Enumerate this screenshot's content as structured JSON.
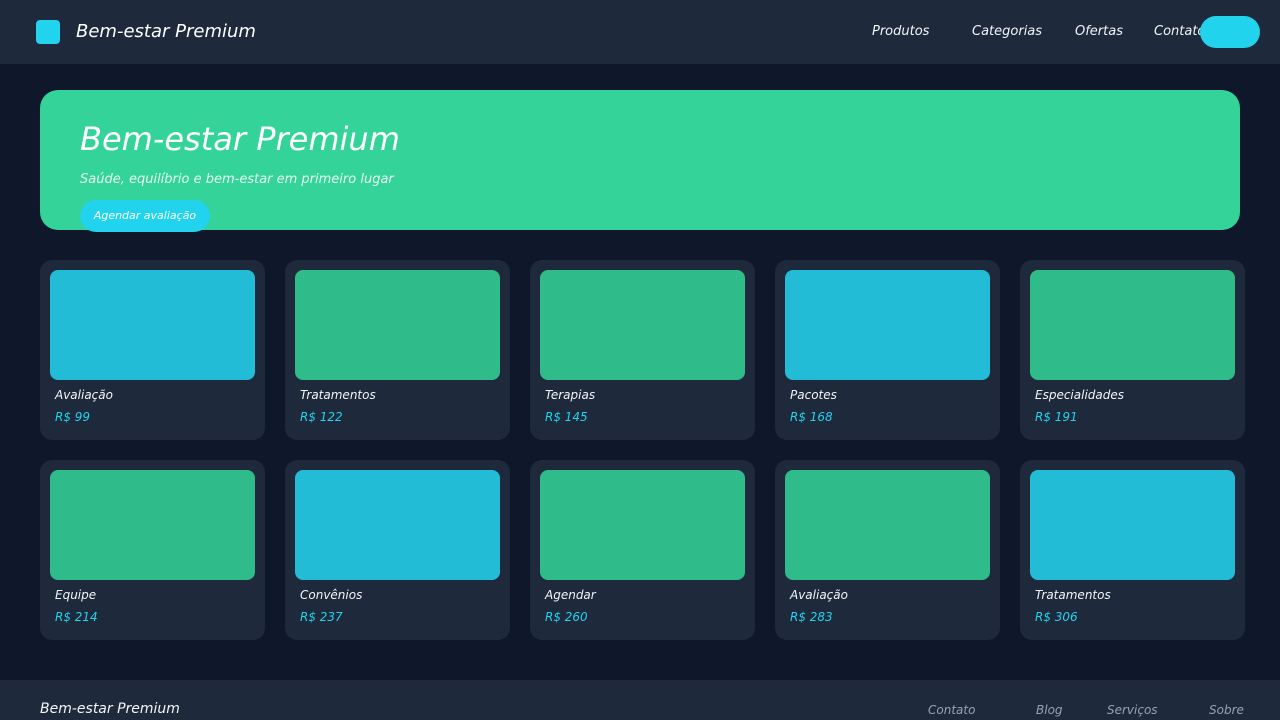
{
  "header": {
    "brand": "Bem-estar Premium",
    "nav": [
      "Produtos",
      "Categorias",
      "Ofertas",
      "Contato"
    ]
  },
  "hero": {
    "title": "Bem-estar Premium",
    "subtitle": "Saúde, equilíbrio e bem-estar em primeiro lugar",
    "cta": "Agendar avaliação"
  },
  "products": [
    {
      "name": "Avaliação",
      "price": "R$ 99",
      "color": "#22bcd6"
    },
    {
      "name": "Tratamentos",
      "price": "R$ 122",
      "color": "#30bb8b"
    },
    {
      "name": "Terapias",
      "price": "R$ 145",
      "color": "#30bb8b"
    },
    {
      "name": "Pacotes",
      "price": "R$ 168",
      "color": "#22bcd6"
    },
    {
      "name": "Especialidades",
      "price": "R$ 191",
      "color": "#30bb8b"
    },
    {
      "name": "Equipe",
      "price": "R$ 214",
      "color": "#30bb8b"
    },
    {
      "name": "Convênios",
      "price": "R$ 237",
      "color": "#22bcd6"
    },
    {
      "name": "Agendar",
      "price": "R$ 260",
      "color": "#30bb8b"
    },
    {
      "name": "Avaliação",
      "price": "R$ 283",
      "color": "#30bb8b"
    },
    {
      "name": "Tratamentos",
      "price": "R$ 306",
      "color": "#22bcd6"
    }
  ],
  "footer": {
    "brand": "Bem-estar Premium",
    "links": [
      "Contato",
      "Blog",
      "Serviços",
      "Sobre"
    ]
  },
  "colors": {
    "background": "#0f172a",
    "surface": "#1e293b",
    "accent": "#22d3ee",
    "hero": "#34d399"
  }
}
